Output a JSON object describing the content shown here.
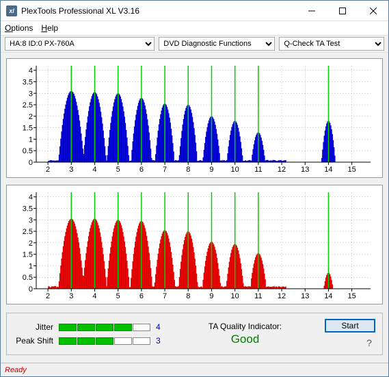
{
  "titlebar": {
    "title": "PlexTools Professional XL V3.16"
  },
  "menubar": {
    "options": "Options",
    "help": "Help"
  },
  "toolbar": {
    "drive": "HA:8 ID:0   PX-760A",
    "func": "DVD Diagnostic Functions",
    "sub": "Q-Check TA Test"
  },
  "chart_data": [
    {
      "type": "bar",
      "color": "#0000d0",
      "x_ticks": [
        2,
        3,
        4,
        5,
        6,
        7,
        8,
        9,
        10,
        11,
        12,
        13,
        14,
        15
      ],
      "y_ticks": [
        0,
        0.5,
        1,
        1.5,
        2,
        2.5,
        3,
        3.5,
        4
      ],
      "xlim": [
        1.5,
        15.8
      ],
      "ylim": [
        0,
        4.2
      ],
      "vlines": [
        3,
        4,
        5,
        6,
        7,
        8,
        9,
        10,
        11,
        14
      ],
      "peaks": [
        {
          "c": 3,
          "h": 3.1,
          "w": 0.55
        },
        {
          "c": 4,
          "h": 3.05,
          "w": 0.5
        },
        {
          "c": 5,
          "h": 3.0,
          "w": 0.48
        },
        {
          "c": 6,
          "h": 2.8,
          "w": 0.45
        },
        {
          "c": 7,
          "h": 2.55,
          "w": 0.42
        },
        {
          "c": 8,
          "h": 2.5,
          "w": 0.4
        },
        {
          "c": 9,
          "h": 2.0,
          "w": 0.38
        },
        {
          "c": 10,
          "h": 1.8,
          "w": 0.35
        },
        {
          "c": 11,
          "h": 1.3,
          "w": 0.3
        },
        {
          "c": 14,
          "h": 1.8,
          "w": 0.3
        }
      ],
      "base_noise": 0.15
    },
    {
      "type": "bar",
      "color": "#e00000",
      "x_ticks": [
        2,
        3,
        4,
        5,
        6,
        7,
        8,
        9,
        10,
        11,
        12,
        13,
        14,
        15
      ],
      "y_ticks": [
        0,
        0.5,
        1,
        1.5,
        2,
        2.5,
        3,
        3.5,
        4
      ],
      "xlim": [
        1.5,
        15.8
      ],
      "ylim": [
        0,
        4.2
      ],
      "vlines": [
        3,
        4,
        5,
        6,
        7,
        8,
        9,
        10,
        11,
        14
      ],
      "peaks": [
        {
          "c": 3,
          "h": 3.05,
          "w": 0.55
        },
        {
          "c": 4,
          "h": 3.05,
          "w": 0.52
        },
        {
          "c": 5,
          "h": 3.0,
          "w": 0.5
        },
        {
          "c": 6,
          "h": 2.95,
          "w": 0.48
        },
        {
          "c": 7,
          "h": 2.55,
          "w": 0.45
        },
        {
          "c": 8,
          "h": 2.5,
          "w": 0.42
        },
        {
          "c": 9,
          "h": 2.05,
          "w": 0.4
        },
        {
          "c": 10,
          "h": 1.95,
          "w": 0.38
        },
        {
          "c": 11,
          "h": 1.55,
          "w": 0.35
        },
        {
          "c": 14,
          "h": 0.7,
          "w": 0.2
        }
      ],
      "base_noise": 0.18
    }
  ],
  "metrics": {
    "jitter": {
      "label": "Jitter",
      "filled": 4,
      "total": 5,
      "value": "4"
    },
    "peak": {
      "label": "Peak Shift",
      "filled": 3,
      "total": 5,
      "value": "3"
    }
  },
  "quality": {
    "label": "TA Quality Indicator:",
    "value": "Good"
  },
  "actions": {
    "start": "Start"
  },
  "status": "Ready"
}
